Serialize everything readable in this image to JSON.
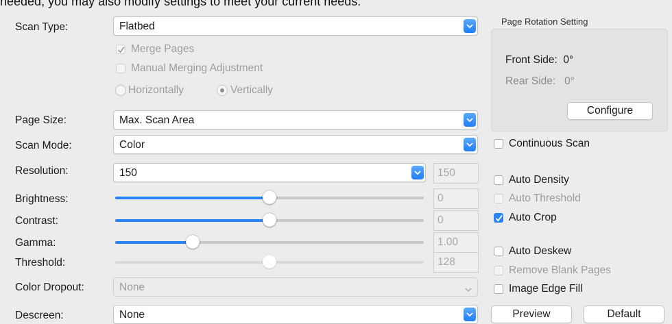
{
  "header_text": "needed, you may also modify settings to meet your current needs.",
  "fields": {
    "scan_type": {
      "label": "Scan Type:",
      "value": "Flatbed"
    },
    "page_size": {
      "label": "Page Size:",
      "value": "Max. Scan Area"
    },
    "scan_mode": {
      "label": "Scan Mode:",
      "value": "Color"
    },
    "resolution": {
      "label": "Resolution:",
      "value": "150",
      "readout": "150"
    },
    "color_dropout": {
      "label": "Color Dropout:",
      "value": "None"
    },
    "descreen": {
      "label": "Descreen:",
      "value": "None"
    }
  },
  "merge": {
    "merge_pages": {
      "label": "Merge Pages",
      "checked": true,
      "enabled": false
    },
    "manual_merging": {
      "label": "Manual Merging Adjustment",
      "checked": false,
      "enabled": false
    },
    "horizontally": {
      "label": "Horizontally",
      "selected": false
    },
    "vertically": {
      "label": "Vertically",
      "selected": true
    }
  },
  "sliders": {
    "brightness": {
      "label": "Brightness:",
      "value": "0",
      "level": 0.5,
      "enabled": true
    },
    "contrast": {
      "label": "Contrast:",
      "value": "0",
      "level": 0.5,
      "enabled": true
    },
    "gamma": {
      "label": "Gamma:",
      "value": "1.00",
      "level": 0.25,
      "enabled": true
    },
    "threshold": {
      "label": "Threshold:",
      "value": "128",
      "level": 0.5,
      "enabled": false
    }
  },
  "rotation": {
    "title": "Page Rotation Setting",
    "front": "Front Side:  0°",
    "rear": "Rear Side:   0°",
    "configure": "Configure"
  },
  "options": {
    "continuous_scan": {
      "label": "Continuous Scan",
      "checked": false,
      "enabled": true
    },
    "auto_density": {
      "label": "Auto Density",
      "checked": false,
      "enabled": true
    },
    "auto_threshold": {
      "label": "Auto Threshold",
      "checked": false,
      "enabled": false
    },
    "auto_crop": {
      "label": "Auto Crop",
      "checked": true,
      "enabled": true
    },
    "auto_deskew": {
      "label": "Auto Deskew",
      "checked": false,
      "enabled": true
    },
    "remove_blank_pages": {
      "label": "Remove Blank Pages",
      "checked": false,
      "enabled": false
    },
    "image_edge_fill": {
      "label": "Image Edge Fill",
      "checked": false,
      "enabled": true
    }
  },
  "buttons": {
    "preview": "Preview",
    "default": "Default"
  },
  "colors": {
    "accent": "#2b84f6",
    "background": "#ececec"
  }
}
